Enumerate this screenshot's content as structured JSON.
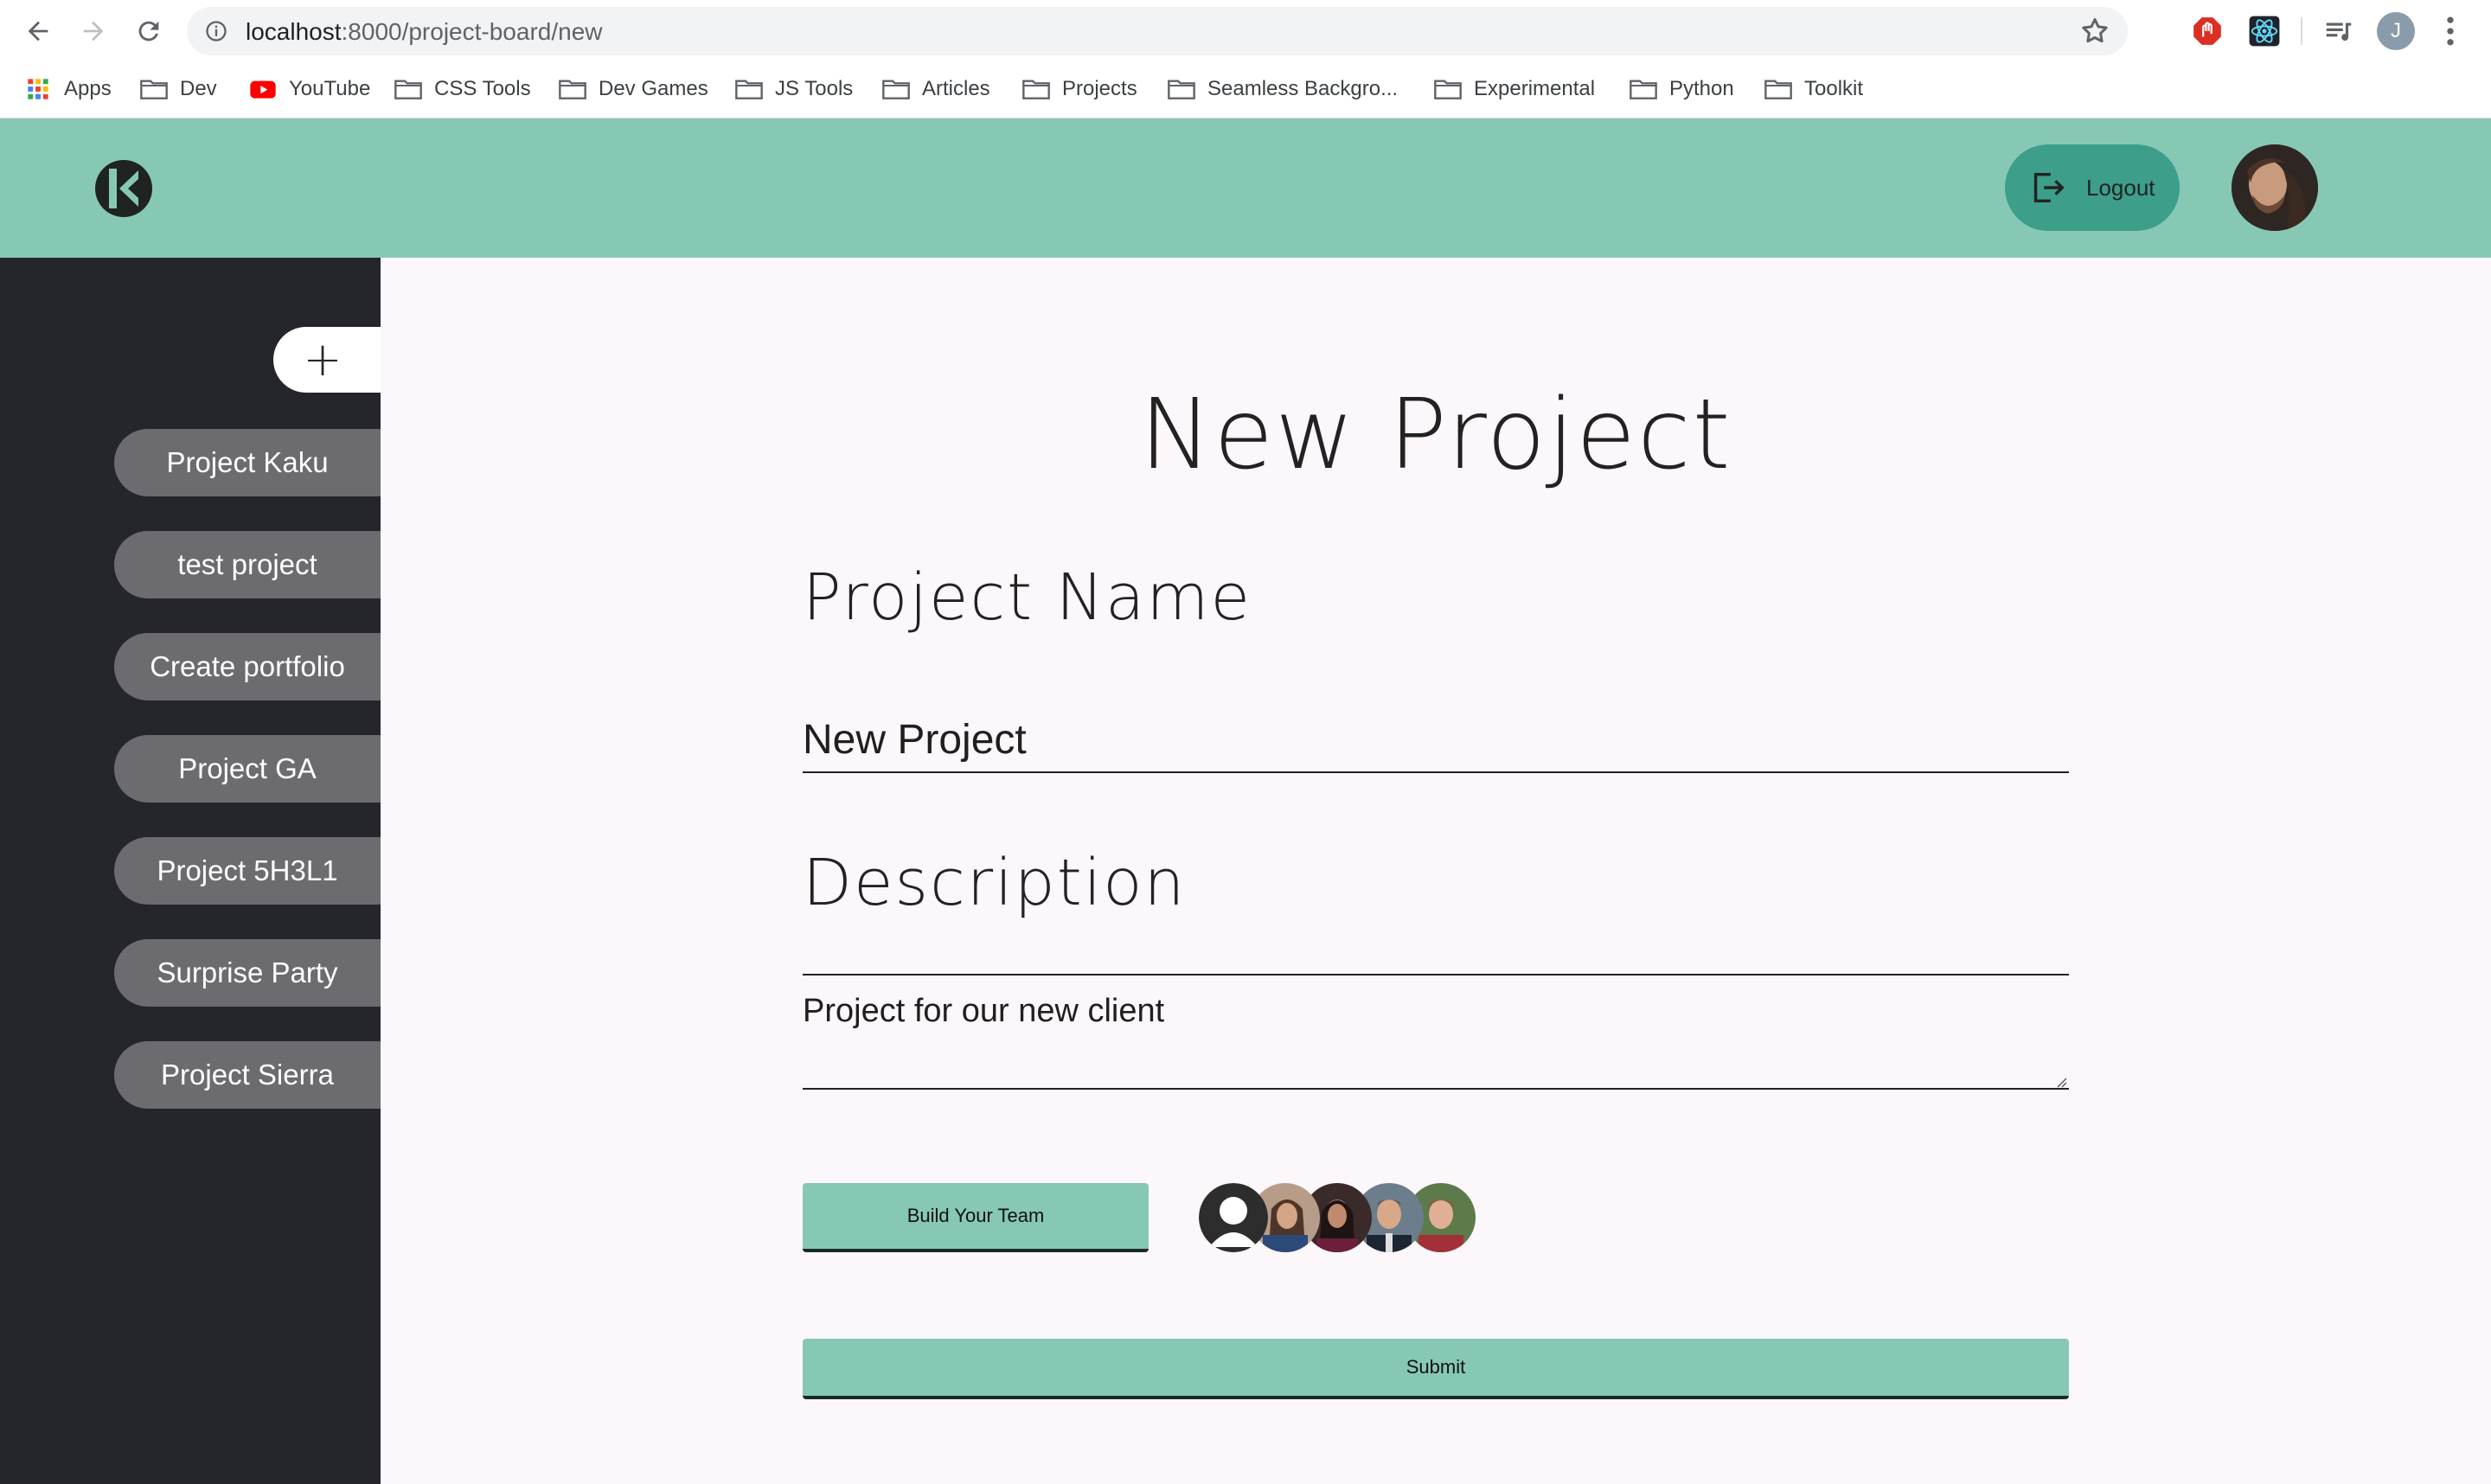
{
  "browser": {
    "url_host": "localhost",
    "url_path": ":8000/project-board/new",
    "profile_initial": "J",
    "bookmarks": [
      {
        "label": "Apps",
        "icon": "apps-grid-icon"
      },
      {
        "label": "Dev",
        "icon": "folder-icon"
      },
      {
        "label": "YouTube",
        "icon": "youtube-icon"
      },
      {
        "label": "CSS Tools",
        "icon": "folder-icon"
      },
      {
        "label": "Dev Games",
        "icon": "folder-icon"
      },
      {
        "label": "JS Tools",
        "icon": "folder-icon"
      },
      {
        "label": "Articles",
        "icon": "folder-icon"
      },
      {
        "label": "Projects",
        "icon": "folder-icon"
      },
      {
        "label": "Seamless Backgro...",
        "icon": "folder-icon"
      },
      {
        "label": "Experimental",
        "icon": "folder-icon"
      },
      {
        "label": "Python",
        "icon": "folder-icon"
      },
      {
        "label": "Toolkit",
        "icon": "folder-icon"
      }
    ]
  },
  "header": {
    "logout_label": "Logout",
    "accent": "#87c8b5",
    "logout_bg": "#3d9e8a"
  },
  "sidebar": {
    "add_label": "+",
    "projects": [
      "Project Kaku",
      "test project",
      "Create portfolio",
      "Project GA",
      "Project 5H3L1",
      "Surprise Party",
      "Project Sierra"
    ]
  },
  "form": {
    "title": "New Project",
    "name_label": "Project Name",
    "name_value": "New Project",
    "description_label": "Description",
    "description_value": "Project for our new client",
    "team_button": "Build Your Team",
    "submit_button": "Submit"
  }
}
